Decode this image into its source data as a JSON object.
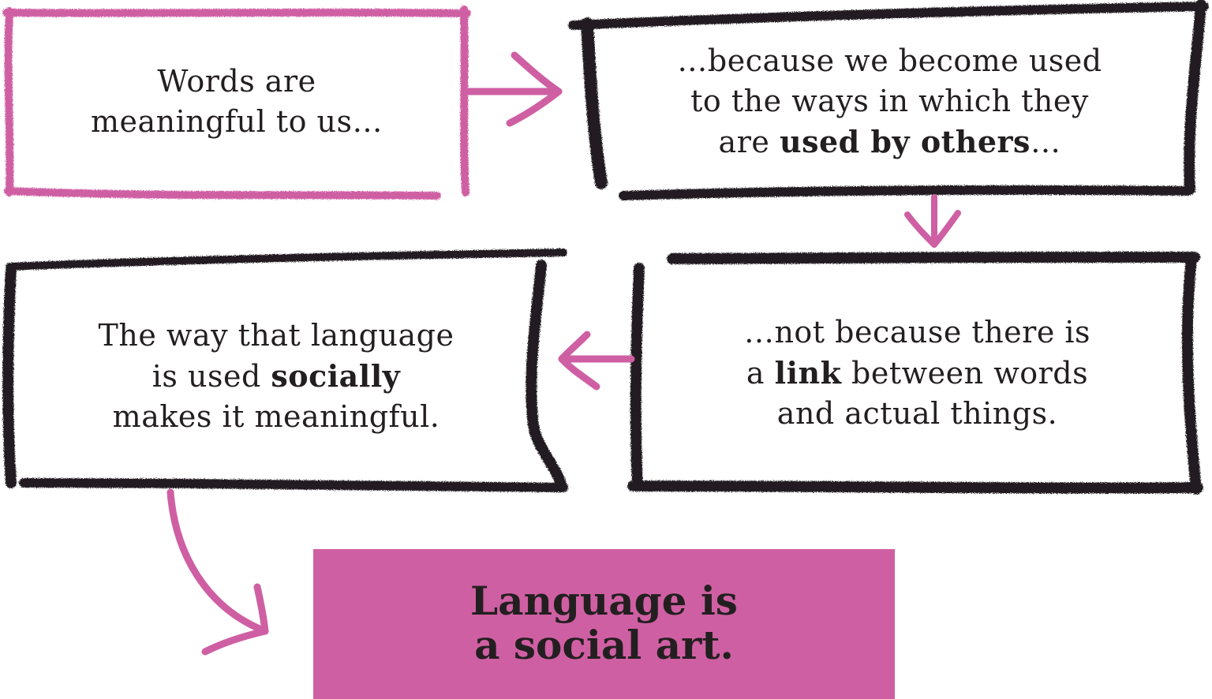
{
  "colors": {
    "pink": "#cf5fa3",
    "ink": "#231f20",
    "background": "#ffffff"
  },
  "boxes": [
    {
      "id": "words-meaningful",
      "lines": [
        [
          {
            "text": "Words are",
            "bold": false
          }
        ],
        [
          {
            "text": "meaningful to us…",
            "bold": false
          }
        ]
      ]
    },
    {
      "id": "used-by-others",
      "lines": [
        [
          {
            "text": "…because we become used",
            "bold": false
          }
        ],
        [
          {
            "text": "to the ways in which they",
            "bold": false
          }
        ],
        [
          {
            "text": "are ",
            "bold": false
          },
          {
            "text": "used by others",
            "bold": true
          },
          {
            "text": "…",
            "bold": false
          }
        ]
      ]
    },
    {
      "id": "used-socially",
      "lines": [
        [
          {
            "text": "The way that language",
            "bold": false
          }
        ],
        [
          {
            "text": "is used ",
            "bold": false
          },
          {
            "text": "socially",
            "bold": true
          }
        ],
        [
          {
            "text": "makes it meaningful.",
            "bold": false
          }
        ]
      ]
    },
    {
      "id": "not-a-link",
      "lines": [
        [
          {
            "text": "…not because there is",
            "bold": false
          }
        ],
        [
          {
            "text": "a ",
            "bold": false
          },
          {
            "text": "link",
            "bold": true
          },
          {
            "text": " between words",
            "bold": false
          }
        ],
        [
          {
            "text": "and actual things.",
            "bold": false
          }
        ]
      ]
    }
  ],
  "conclusion": {
    "line1": "Language is",
    "line2": "a social art."
  },
  "arrows": [
    {
      "from": "words-meaningful",
      "to": "used-by-others"
    },
    {
      "from": "used-by-others",
      "to": "not-a-link"
    },
    {
      "from": "not-a-link",
      "to": "used-socially"
    },
    {
      "from": "used-socially",
      "to": "conclusion"
    }
  ]
}
